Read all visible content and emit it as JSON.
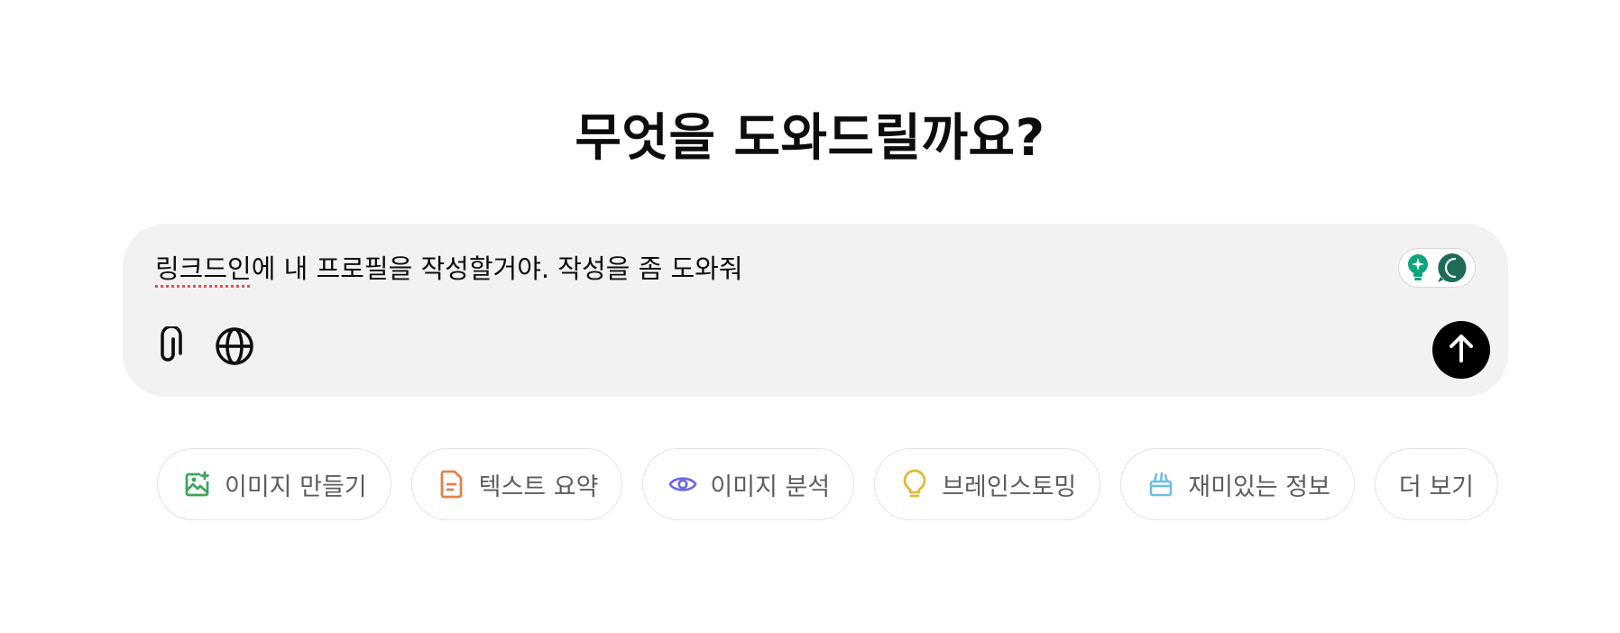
{
  "heading": "무엇을 도와드릴까요?",
  "composer": {
    "text_underlined": "링크드인",
    "text_rest": "에 내 프로필을 작성할거야. 작성을 좀 도와줘",
    "attach_icon": "paperclip-icon",
    "web_icon": "globe-icon",
    "send_icon": "arrow-up-icon",
    "extension_icons": [
      "lightbulb-icon",
      "chat-bubble-icon"
    ]
  },
  "chips": [
    {
      "label": "이미지 만들기",
      "icon": "image-create-icon",
      "color": "#3da35d"
    },
    {
      "label": "텍스트 요약",
      "icon": "document-icon",
      "color": "#e2814c"
    },
    {
      "label": "이미지 분석",
      "icon": "eye-icon",
      "color": "#6b68e0"
    },
    {
      "label": "브레인스토밍",
      "icon": "lightbulb-icon",
      "color": "#e0b83a"
    },
    {
      "label": "재미있는 정보",
      "icon": "graduation-cap-icon",
      "color": "#6cbfe3"
    },
    {
      "label": "더 보기"
    }
  ],
  "colors": {
    "composer_bg": "#f2f2f2",
    "send_bg": "#000000",
    "chip_border": "#e3e3e3",
    "extension_teal": "#10a37f",
    "extension_dark": "#1f6b5a",
    "spellcheck_underline": "#e05252"
  }
}
